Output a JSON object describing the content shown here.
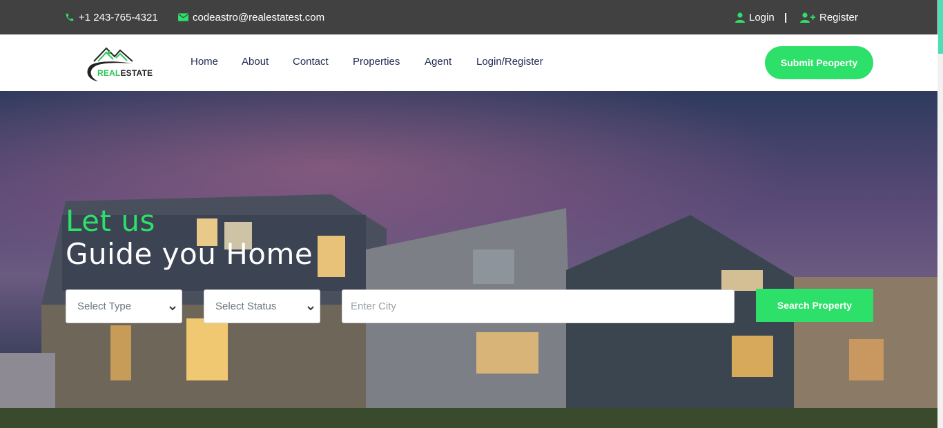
{
  "topbar": {
    "phone": "+1 243-765-4321",
    "email": "codeastro@realestatest.com",
    "login": "Login",
    "separator": "|",
    "register": "Register",
    "phone_icon": "phone-icon",
    "email_icon": "envelope-icon",
    "login_icon": "user-icon",
    "register_icon": "user-plus-icon"
  },
  "logo": {
    "part1": "REAL",
    "part2": "ESTATE"
  },
  "nav": {
    "items": [
      {
        "label": "Home"
      },
      {
        "label": "About"
      },
      {
        "label": "Contact"
      },
      {
        "label": "Properties"
      },
      {
        "label": "Agent"
      },
      {
        "label": "Login/Register"
      }
    ],
    "submit_label": "Submit Peoperty"
  },
  "hero": {
    "line1": "Let us",
    "line2": "Guide you Home",
    "select_type": "Select Type",
    "select_status": "Select Status",
    "city_placeholder": "Enter City",
    "search_label": "Search Property"
  },
  "colors": {
    "accent": "#2de069",
    "topbar_bg": "#414141",
    "nav_text": "#1d2b4f"
  }
}
